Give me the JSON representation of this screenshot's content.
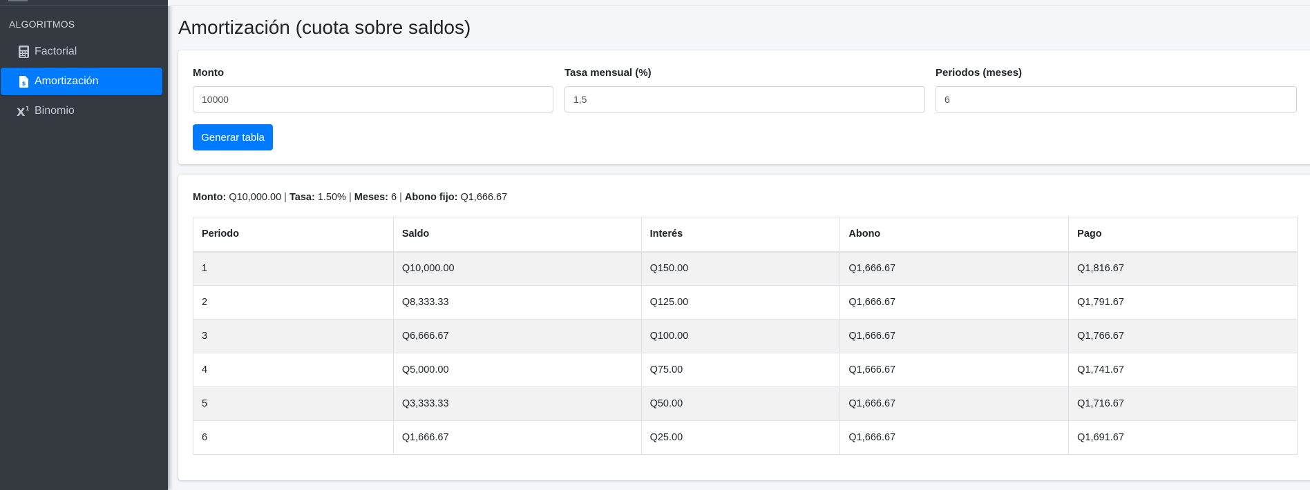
{
  "sidebar": {
    "header": "ALGORITMOS",
    "items": [
      {
        "label": "Factorial",
        "icon": "calculator-icon"
      },
      {
        "label": "Amortización",
        "icon": "file-invoice-dollar-icon",
        "active": true
      },
      {
        "label": "Binomio",
        "icon": "superscript-icon"
      }
    ]
  },
  "page": {
    "title": "Amortización (cuota sobre saldos)"
  },
  "form": {
    "monto_label": "Monto",
    "monto_value": "10000",
    "tasa_label": "Tasa mensual (%)",
    "tasa_value": "1,5",
    "periodos_label": "Periodos (meses)",
    "periodos_value": "6",
    "submit_label": "Generar tabla"
  },
  "summary": {
    "monto_label": "Monto:",
    "monto_value": "Q10,000.00",
    "tasa_label": "Tasa:",
    "tasa_value": "1.50%",
    "meses_label": "Meses:",
    "meses_value": "6",
    "abono_label": "Abono fijo:",
    "abono_value": "Q1,666.67",
    "separator": "|"
  },
  "table": {
    "headers": [
      "Periodo",
      "Saldo",
      "Interés",
      "Abono",
      "Pago"
    ],
    "rows": [
      [
        "1",
        "Q10,000.00",
        "Q150.00",
        "Q1,666.67",
        "Q1,816.67"
      ],
      [
        "2",
        "Q8,333.33",
        "Q125.00",
        "Q1,666.67",
        "Q1,791.67"
      ],
      [
        "3",
        "Q6,666.67",
        "Q100.00",
        "Q1,666.67",
        "Q1,766.67"
      ],
      [
        "4",
        "Q5,000.00",
        "Q75.00",
        "Q1,666.67",
        "Q1,741.67"
      ],
      [
        "5",
        "Q3,333.33",
        "Q50.00",
        "Q1,666.67",
        "Q1,716.67"
      ],
      [
        "6",
        "Q1,666.67",
        "Q25.00",
        "Q1,666.67",
        "Q1,691.67"
      ]
    ]
  },
  "colors": {
    "sidebar_bg": "#343a40",
    "accent": "#007bff",
    "page_bg": "#f4f6f9"
  }
}
